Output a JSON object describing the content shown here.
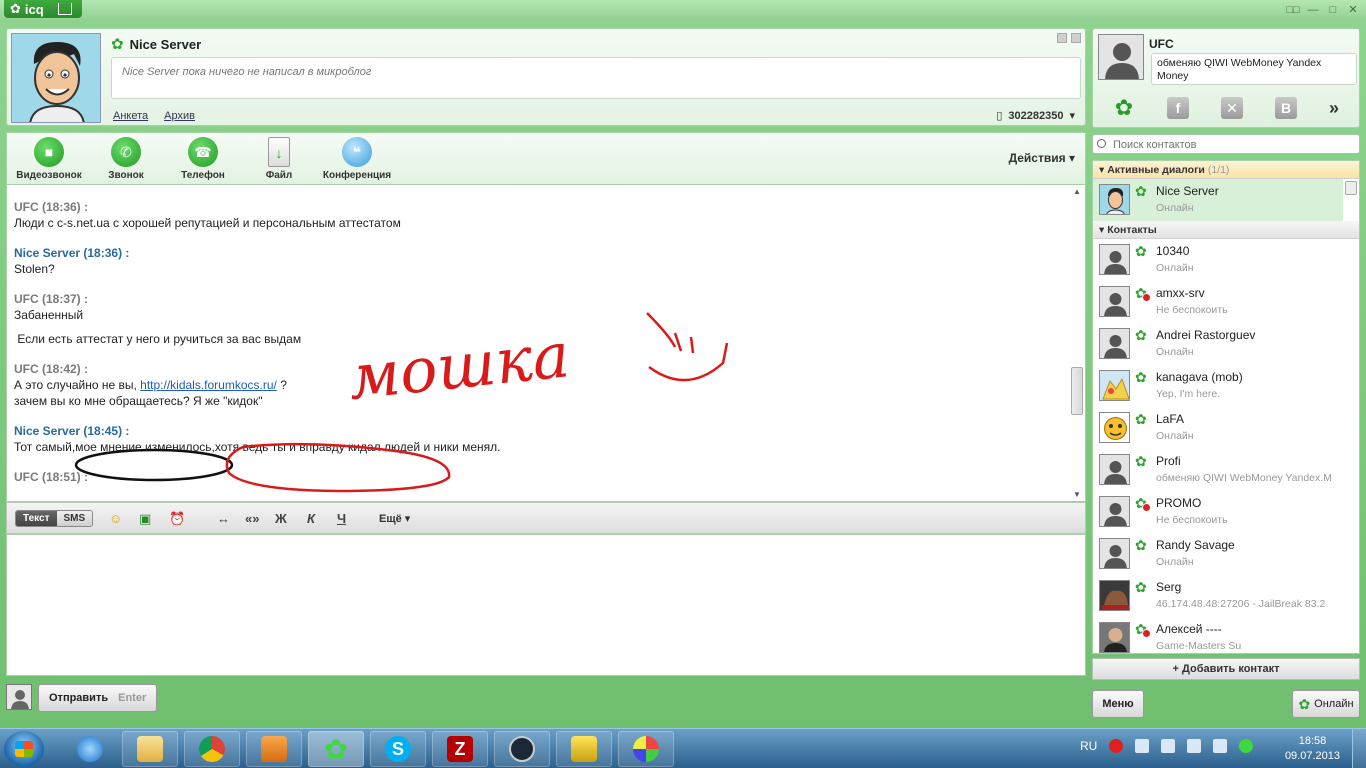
{
  "app": {
    "logo": "icq",
    "window_controls": [
      "□□",
      "—",
      "□",
      "✕"
    ]
  },
  "chat": {
    "contact_name": "Nice Server",
    "microblog_placeholder": "Nice Server пока ничего не написал в микроблог",
    "links": {
      "profile": "Анкета",
      "archive": "Архив"
    },
    "phone": "302282350",
    "toolbar": {
      "video": "Видеозвонок",
      "call": "Звонок",
      "phone": "Телефон",
      "file": "Файл",
      "conference": "Конференция",
      "actions": "Действия"
    },
    "messages": [
      {
        "author": "UFC (18:36) :",
        "other": false,
        "lines": [
          "Люди с c-s.net.ua с хорошей репутацией и персональным аттестатом"
        ]
      },
      {
        "author": "Nice Server (18:36) :",
        "other": true,
        "lines": [
          "Stolen?"
        ]
      },
      {
        "author": "UFC (18:37) :",
        "other": false,
        "lines": [
          "Забаненный",
          "",
          " Если есть аттестат у него и ручиться за вас выдам"
        ]
      },
      {
        "author": "UFC (18:42) :",
        "other": false,
        "lines": [
          "А это случайно не вы, ",
          "зачем вы ко мне обращаетесь? Я же \"кидок\""
        ],
        "link": "http://kidals.forumkocs.ru/",
        "link_suffix": " ?"
      },
      {
        "author": "Nice Server (18:45) :",
        "other": true,
        "lines": [
          "Тот самый,мое мнение изменилось,хотя ведь ты и вправду кидал людей и ники менял."
        ]
      },
      {
        "author": "UFC (18:51) :",
        "other": false,
        "lines": [
          ""
        ]
      }
    ],
    "format": {
      "text_tab": "Текст",
      "sms_tab": "SMS",
      "translit": "↔",
      "quote": "«»",
      "bold": "Ж",
      "italic": "К",
      "underline": "Ч",
      "more": "Ещё"
    },
    "input_value": "",
    "send": {
      "label": "Отправить",
      "key": "Enter"
    }
  },
  "profile": {
    "name": "UFC",
    "status": "обменяю QIWI WebMoney Yandex Money",
    "social_icons": [
      "icq-icon",
      "facebook-icon",
      "odnoklassniki-icon",
      "vkontakte-icon"
    ],
    "more": "»"
  },
  "contacts": {
    "search_placeholder": "Поиск контактов",
    "active_group": "Активные диалоги",
    "active_count": "(1/1)",
    "contacts_group": "Контакты",
    "active": [
      {
        "name": "Nice Server",
        "status": "Онлайн",
        "dnd": false
      }
    ],
    "list": [
      {
        "name": "10340",
        "status": "Онлайн",
        "dnd": false
      },
      {
        "name": "amxx-srv",
        "status": "Не беспокоить",
        "dnd": true
      },
      {
        "name": "Andrei Rastorguev",
        "status": "Онлайн",
        "dnd": false
      },
      {
        "name": "kanagava (mob)",
        "status": "Yep, I'm here.",
        "dnd": false
      },
      {
        "name": "LaFA",
        "status": "Онлайн",
        "dnd": false
      },
      {
        "name": "Profi",
        "status": "обменяю QIWI WebMoney Yandex.M",
        "dnd": false
      },
      {
        "name": "PROMO",
        "status": "Не беспокоить",
        "dnd": true
      },
      {
        "name": "Randy Savage",
        "status": "Онлайн",
        "dnd": false
      },
      {
        "name": "Serg",
        "status": "46.174.48.48:27206 - JailBreak 83.2",
        "dnd": false
      },
      {
        "name": "Алексей ----",
        "status": "Game-Masters Su",
        "dnd": true
      }
    ],
    "add_contact": "+ Добавить контакт"
  },
  "bottom": {
    "menu": "Меню",
    "status": "Онлайн"
  },
  "taskbar": {
    "language": "RU",
    "time": "18:58",
    "date": "09.07.2013",
    "apps": [
      "explorer",
      "chrome",
      "media",
      "icq",
      "skype",
      "filezilla",
      "steam",
      "game",
      "paint"
    ]
  },
  "annotation": "мошка",
  "colors": {
    "icq_green": "#2fa52f",
    "frame_green": "#7cc77c",
    "link_blue": "#1a5fb4",
    "author_blue": "#2b6a9c",
    "annotation_red": "#d81a1a"
  }
}
